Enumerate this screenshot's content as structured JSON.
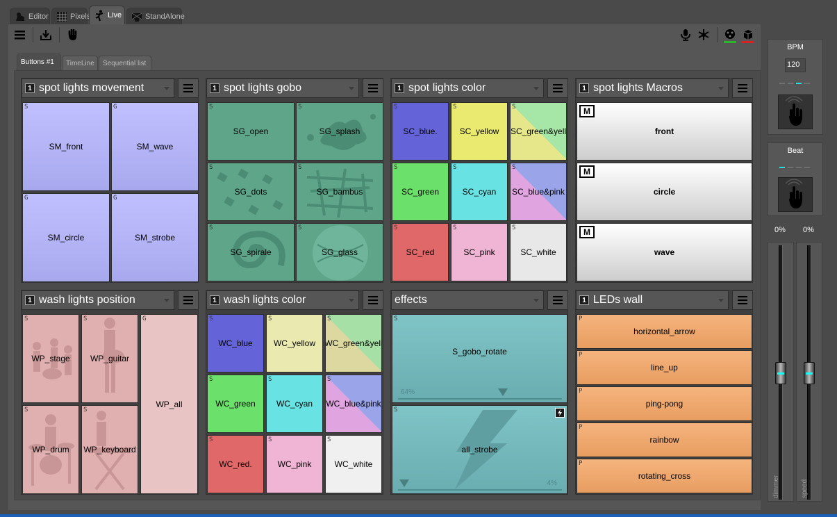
{
  "top_tabs": [
    {
      "label": "Editor",
      "icon": "editor-icon"
    },
    {
      "label": "Pixels",
      "icon": "pixels-grid-icon"
    },
    {
      "label": "Live",
      "icon": "dancer-icon"
    },
    {
      "label": "StandAlone",
      "icon": "standalone-icon"
    }
  ],
  "sub_tabs": [
    "Buttons #1",
    "TimeLine",
    "Sequential list"
  ],
  "panels": {
    "spot_movement": {
      "num": "1",
      "title": "spot lights movement"
    },
    "spot_gobo": {
      "num": "1",
      "title": "spot lights gobo"
    },
    "spot_color": {
      "num": "1",
      "title": "spot lights color"
    },
    "spot_macros": {
      "num": "1",
      "title": "spot lights Macros"
    },
    "wash_position": {
      "num": "1",
      "title": "wash lights position"
    },
    "wash_color": {
      "num": "1",
      "title": "wash lights color"
    },
    "effects": {
      "title": "effects"
    },
    "leds_wall": {
      "num": "1",
      "title": "LEDs wall"
    }
  },
  "buttons": {
    "sm": [
      {
        "mode": "S",
        "label": "SM_front"
      },
      {
        "mode": "G",
        "label": "SM_wave"
      },
      {
        "mode": "G",
        "label": "SM_circle"
      },
      {
        "mode": "G",
        "label": "SM_strobe"
      }
    ],
    "sg": [
      {
        "mode": "S",
        "label": "SG_open"
      },
      {
        "mode": "S",
        "label": "SG_splash"
      },
      {
        "mode": "S",
        "label": "SG_dots"
      },
      {
        "mode": "S",
        "label": "SG_bambus"
      },
      {
        "mode": "S",
        "label": "SG_spirale"
      },
      {
        "mode": "S",
        "label": "SG_glass"
      }
    ],
    "sc": [
      {
        "mode": "S",
        "label": "SC_blue."
      },
      {
        "mode": "S",
        "label": "SC_yellow"
      },
      {
        "mode": "S",
        "label": "SC_green&yell"
      },
      {
        "mode": "S",
        "label": "SC_green"
      },
      {
        "mode": "S",
        "label": "SC_cyan"
      },
      {
        "mode": "S",
        "label": "SC_blue&pink"
      },
      {
        "mode": "S",
        "label": "SC_red"
      },
      {
        "mode": "S",
        "label": "SC_pink"
      },
      {
        "mode": "S",
        "label": "SC_white"
      }
    ],
    "macros": [
      {
        "mode": "M",
        "label": "front"
      },
      {
        "mode": "M",
        "label": "circle"
      },
      {
        "mode": "M",
        "label": "wave"
      }
    ],
    "wp": [
      {
        "mode": "S",
        "label": "WP_stage"
      },
      {
        "mode": "S",
        "label": "WP_guitar"
      },
      {
        "mode": "G",
        "label": "WP_all"
      },
      {
        "mode": "S",
        "label": "WP_drum"
      },
      {
        "mode": "S",
        "label": "WP_keyboard"
      }
    ],
    "wc": [
      {
        "mode": "S",
        "label": "WC_blue"
      },
      {
        "mode": "S",
        "label": "WC_yellow"
      },
      {
        "mode": "S",
        "label": "WC_green&yell"
      },
      {
        "mode": "S",
        "label": "WC_green"
      },
      {
        "mode": "S",
        "label": "WC_cyan"
      },
      {
        "mode": "S",
        "label": "WC_blue&pink"
      },
      {
        "mode": "S",
        "label": "WC_red."
      },
      {
        "mode": "S",
        "label": "WC_pink"
      },
      {
        "mode": "S",
        "label": "WC_white"
      }
    ],
    "effects": [
      {
        "mode": "S",
        "label": "S_gobo_rotate",
        "percent": "64%",
        "level": 0.64
      },
      {
        "mode": "S",
        "label": "all_strobe",
        "percent": "4%",
        "level": 0.04
      }
    ],
    "leds": [
      {
        "mode": "P",
        "label": "horizontal_arrow"
      },
      {
        "mode": "P",
        "label": "line_up"
      },
      {
        "mode": "P",
        "label": "ping-pong"
      },
      {
        "mode": "P",
        "label": "rainbow"
      },
      {
        "mode": "P",
        "label": "rotating_cross"
      }
    ]
  },
  "bpm": {
    "title": "BPM",
    "value": "120"
  },
  "beat": {
    "title": "Beat"
  },
  "sliders": {
    "dimmer": {
      "percent": "0%",
      "label": "dimmer",
      "level": 0
    },
    "speed": {
      "percent": "0%",
      "label": "speed",
      "level": 0
    }
  },
  "colors": {
    "sc_blue": "#6464d8",
    "sc_yellow": "#eaea70",
    "sc_green": "#6be06b",
    "sc_cyan": "#68e2e2",
    "sc_red": "#e06868",
    "sc_pink": "#f0b4d4",
    "sc_white": "#e8e8e8",
    "led_orange": "#f0a868",
    "accent_cyan": "#22e0e0"
  }
}
